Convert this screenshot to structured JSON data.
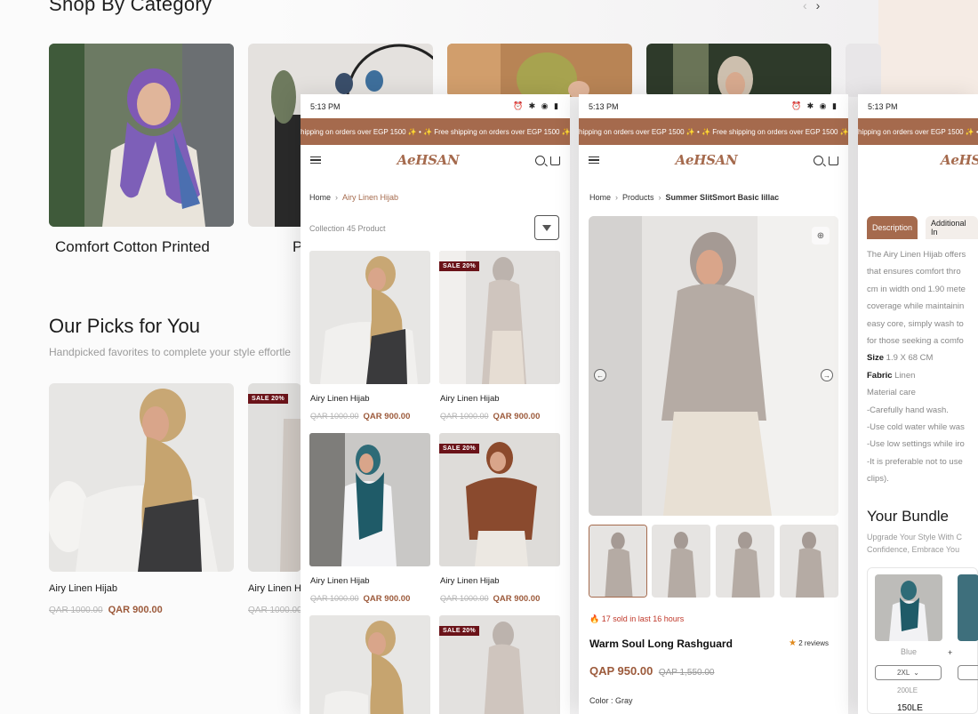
{
  "background": {
    "shop_by_category": {
      "title": "Shop By Category",
      "prev_arrow": "‹",
      "next_arrow": "›",
      "categories": [
        {
          "label": "Comfort Cotton Printed"
        },
        {
          "label": "P"
        }
      ]
    },
    "picks": {
      "title": "Our Picks for You",
      "subtitle": "Handpicked favorites to complete your style effortle",
      "products": [
        {
          "name": "Airy Linen Hijab",
          "old_price": "QAR 1000.00",
          "price": "QAR 900.00",
          "sale": ""
        },
        {
          "name": "Airy Linen Hi",
          "old_price": "QAR 1000.00",
          "price": "",
          "sale": "SALE 20%"
        }
      ]
    }
  },
  "common": {
    "time": "5:13 PM",
    "status_icons": "⏰ ✱ ◉ ▮",
    "banner_text": "hipping on orders over EGP 1500 ✨  •  ✨ Free shipping on orders over EGP 1500 ✨",
    "logo": "AeHSAN"
  },
  "listing": {
    "breadcrumb": {
      "home": "Home",
      "current": "Airy Linen Hijab"
    },
    "collection_count": "Collection 45 Product",
    "products": [
      {
        "name": "Airy Linen Hijab",
        "old_price": "QAR 1000.00",
        "price": "QAR 900.00",
        "sale": ""
      },
      {
        "name": "Airy Linen Hijab",
        "old_price": "QAR 1000.00",
        "price": "QAR 900.00",
        "sale": "SALE 20%"
      },
      {
        "name": "Airy Linen Hijab",
        "old_price": "QAR 1000.00",
        "price": "QAR 900.00",
        "sale": ""
      },
      {
        "name": "Airy Linen Hijab",
        "old_price": "QAR 1000.00",
        "price": "QAR 900.00",
        "sale": "SALE 20%"
      },
      {
        "name": "",
        "old_price": "",
        "price": "",
        "sale": ""
      },
      {
        "name": "",
        "old_price": "",
        "price": "",
        "sale": "SALE 20%"
      }
    ]
  },
  "detail": {
    "breadcrumb": {
      "home": "Home",
      "products": "Products",
      "current": "Summer SlitSmort Basic lillac"
    },
    "sold_notice": "17 sold in last 16 hours",
    "title": "Warm Soul Long Rashguard",
    "reviews": "2 reviews",
    "price": "QAP 950.00",
    "old_price": "QAP 1,550.00",
    "color_label": "Color : Gray"
  },
  "info": {
    "tabs": [
      {
        "label": "Description"
      },
      {
        "label": "Additional In"
      }
    ],
    "desc_lines": [
      "The Airy Linen Hijab offers",
      "that ensures comfort thro",
      "cm in width ond 1.90 mete",
      "coverage while maintainin",
      "easy core, simply wash to",
      "for those seeking a comfo"
    ],
    "size_label": "Size",
    "size_value": "1.9 X 68 CM",
    "fabric_label": "Fabric",
    "fabric_value": "Linen",
    "care_lines": [
      "Material care",
      "-Carefully hand wash.",
      "-Use cold water while was",
      "-Use low settings while iro",
      "-It is preferable not to use",
      "clips)."
    ],
    "bundle_title": "Your Bundle",
    "bundle_sub1": "Upgrade Your Style With C",
    "bundle_sub2": "Confidence, Embrace You",
    "bundle_item": {
      "color": "Blue",
      "size": "2XL",
      "old_price": "200LE",
      "price": "150LE"
    },
    "plus": "+"
  },
  "colors": {
    "accent": "#a56a4d",
    "sale_badge": "#6b1319",
    "price": "#9c5a3b"
  }
}
